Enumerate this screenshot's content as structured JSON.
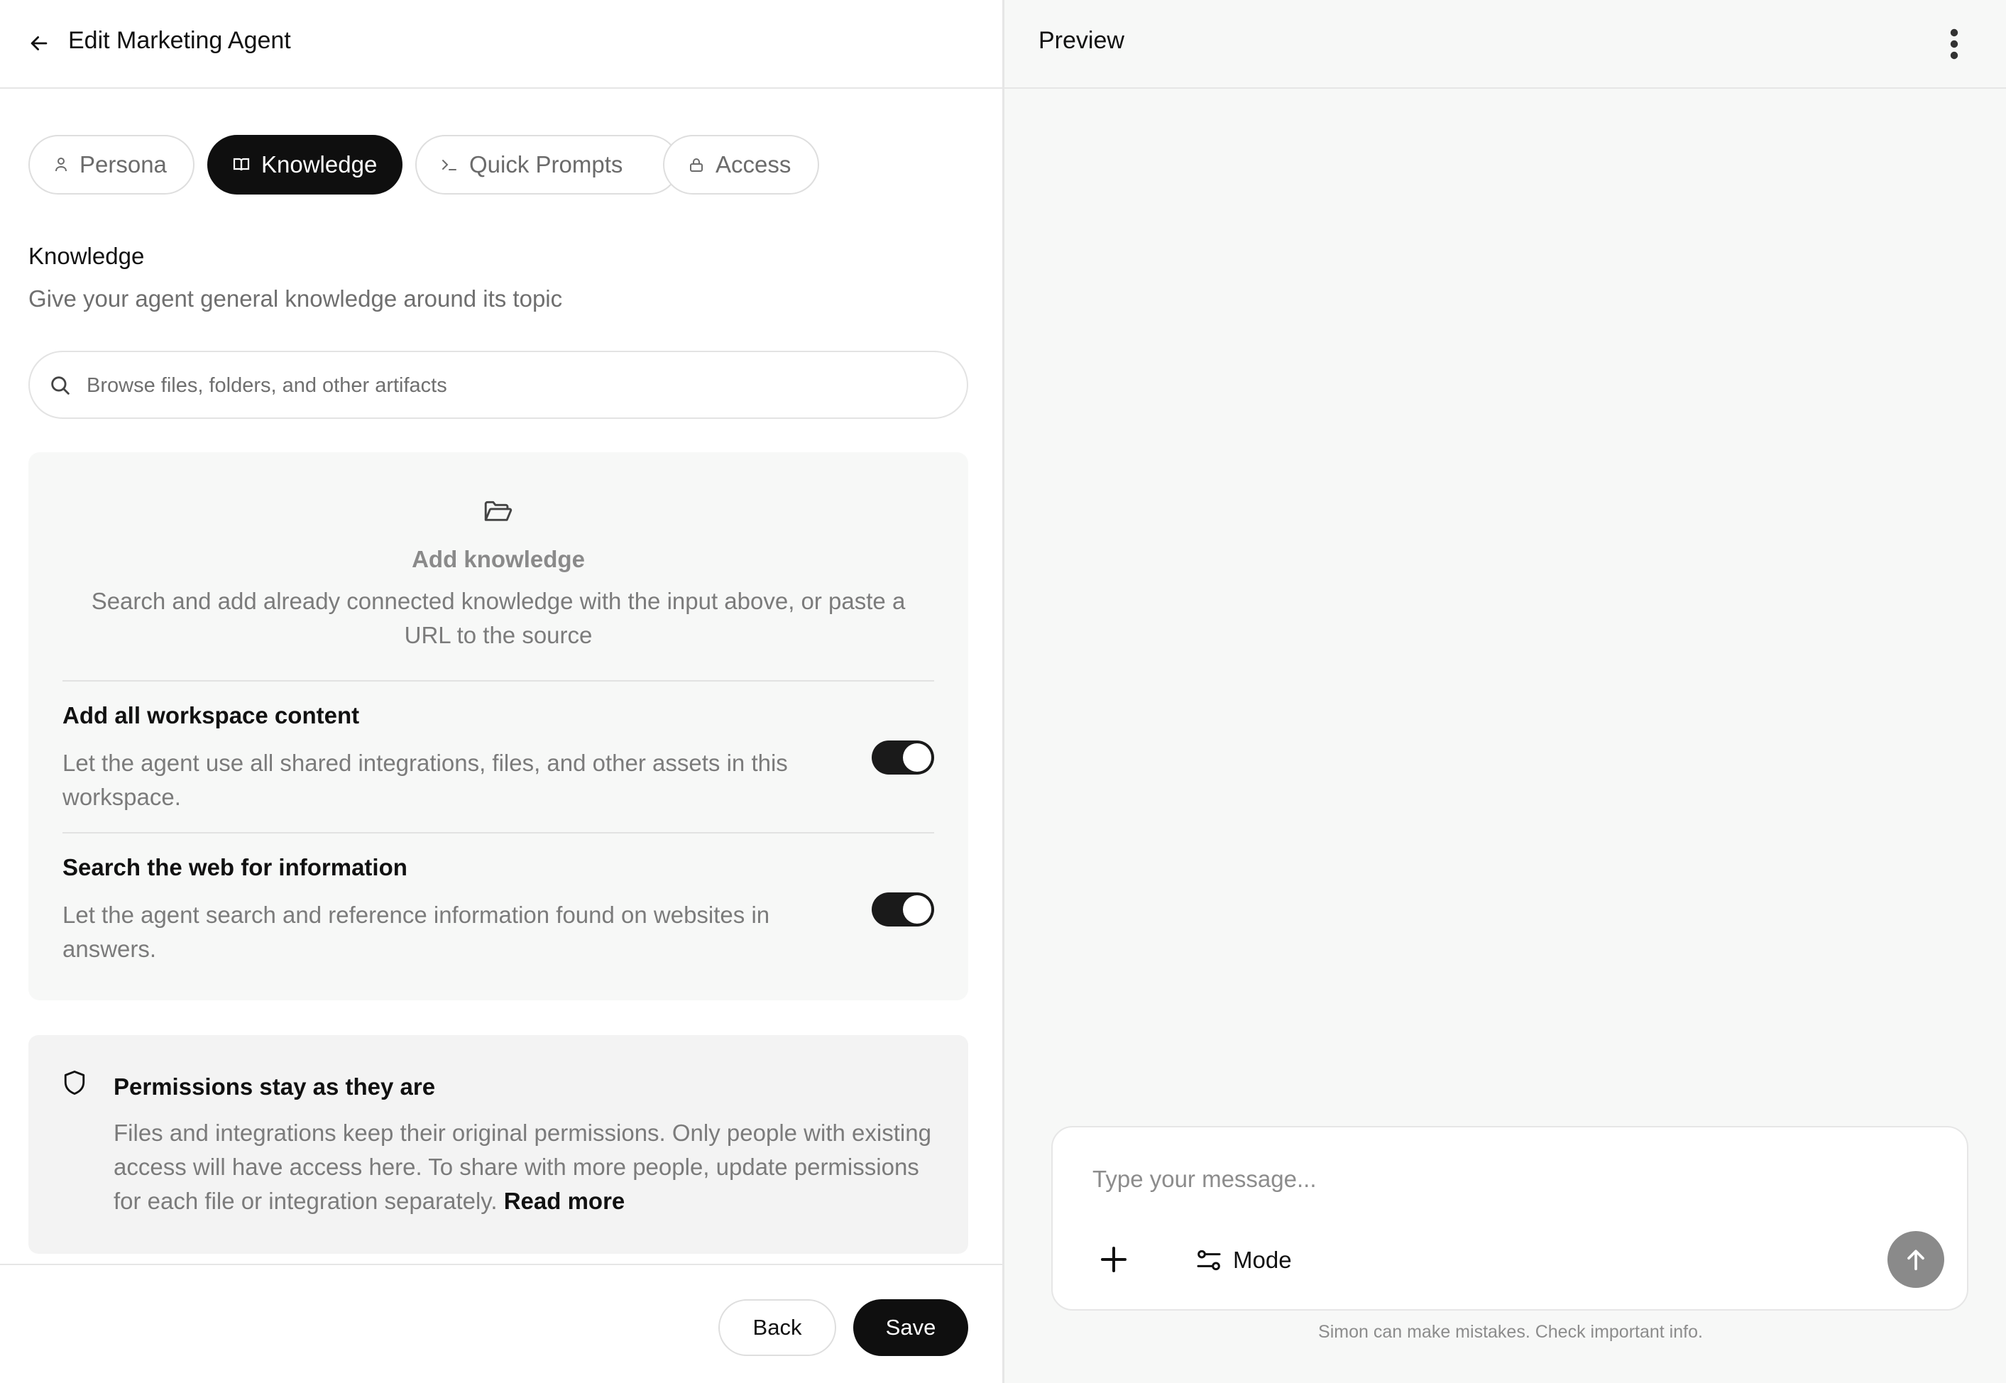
{
  "header": {
    "title": "Edit Marketing Agent"
  },
  "tabs": [
    {
      "label": "Persona",
      "icon": "person-icon",
      "active": false
    },
    {
      "label": "Knowledge",
      "icon": "book-icon",
      "active": true
    },
    {
      "label": "Quick Prompts",
      "icon": "terminal-prompt-icon",
      "active": false
    },
    {
      "label": "Access",
      "icon": "lock-icon",
      "active": false
    }
  ],
  "knowledge": {
    "title": "Knowledge",
    "subtitle": "Give your agent general knowledge around its topic",
    "search_placeholder": "Browse files, folders, and other artifacts",
    "empty_title": "Add knowledge",
    "empty_text": "Search and add already connected knowledge with the input above, or paste a URL to the source",
    "options": [
      {
        "title": "Add all workspace content",
        "description": "Let the agent use all shared integrations, files, and other assets in this workspace.",
        "enabled": true
      },
      {
        "title": "Search the web for information",
        "description": "Let the agent search and reference information found on websites in answers.",
        "enabled": true
      }
    ]
  },
  "permissions": {
    "title": "Permissions stay as they are",
    "text": "Files and integrations keep their original permissions. Only people with existing access will have access here. To share with more people, update permissions for each file or integration separately.",
    "link_label": "Read more"
  },
  "footer": {
    "back_label": "Back",
    "save_label": "Save"
  },
  "preview": {
    "title": "Preview",
    "message_placeholder": "Type your message...",
    "mode_label": "Mode",
    "disclaimer": "Simon can make mistakes. Check important info."
  },
  "colors": {
    "primary": "#0f0f0f",
    "send_button": "#8a8a8a",
    "panel_bg": "#f7f8f7"
  }
}
